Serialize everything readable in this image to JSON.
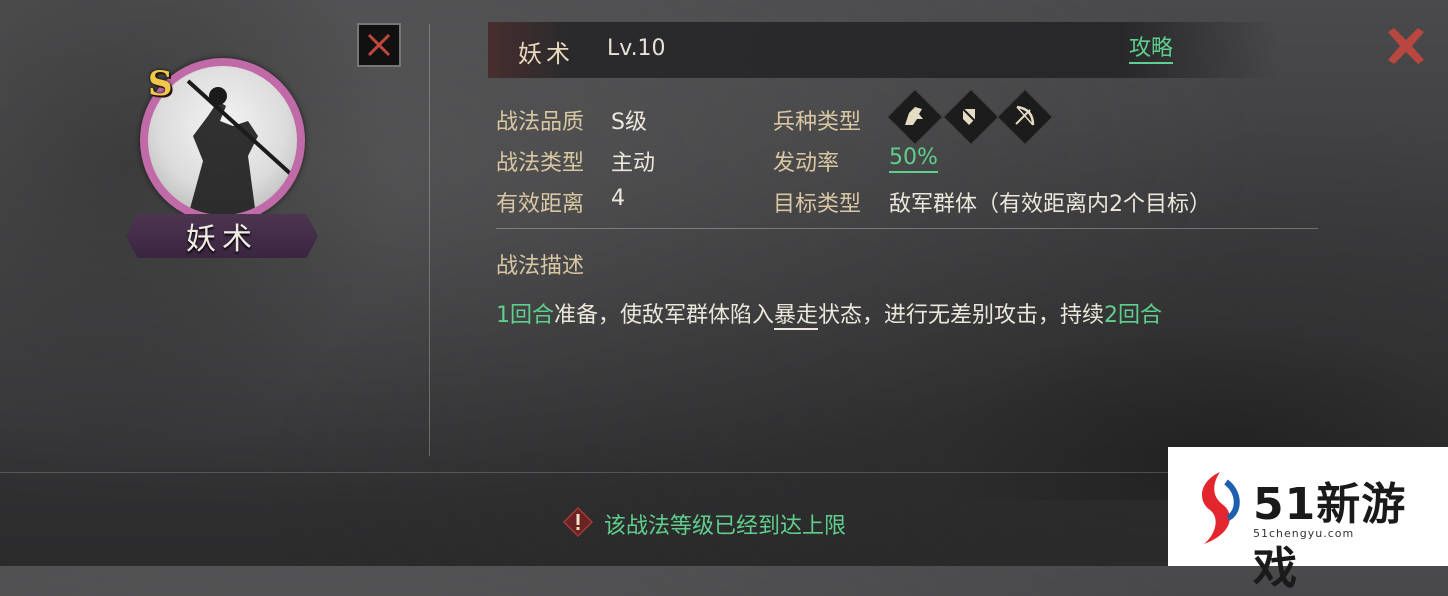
{
  "skill": {
    "name": "妖术",
    "level": "Lv.10",
    "grade_badge": "S",
    "portrait_name": "妖术"
  },
  "header": {
    "guide_link": "攻略"
  },
  "stats": {
    "quality_label": "战法品质",
    "quality_value": "S级",
    "type_label": "战法类型",
    "type_value": "主动",
    "range_label": "有效距离",
    "range_value": "4",
    "unit_type_label": "兵种类型",
    "unit_icons": [
      "cavalry-icon",
      "shield-infantry-icon",
      "archer-icon"
    ],
    "trigger_label": "发动率",
    "trigger_value": "50%",
    "target_label": "目标类型",
    "target_value": "敌军群体（有效距离内2个目标）"
  },
  "description": {
    "title": "战法描述",
    "seg1": "1回合",
    "seg2": "准备，使敌军群体陷入",
    "seg3": "暴走",
    "seg4": "状态，进行无差别攻击，持续",
    "seg5": "2回合"
  },
  "footer": {
    "max_level_notice": "该战法等级已经到达上限"
  },
  "watermark": {
    "brand": "51新游戏",
    "url": "51chengyu.com"
  },
  "colors": {
    "accent_green": "#5fcf8d",
    "label_gold": "#d9c7a3",
    "close_red": "#c0463f"
  }
}
